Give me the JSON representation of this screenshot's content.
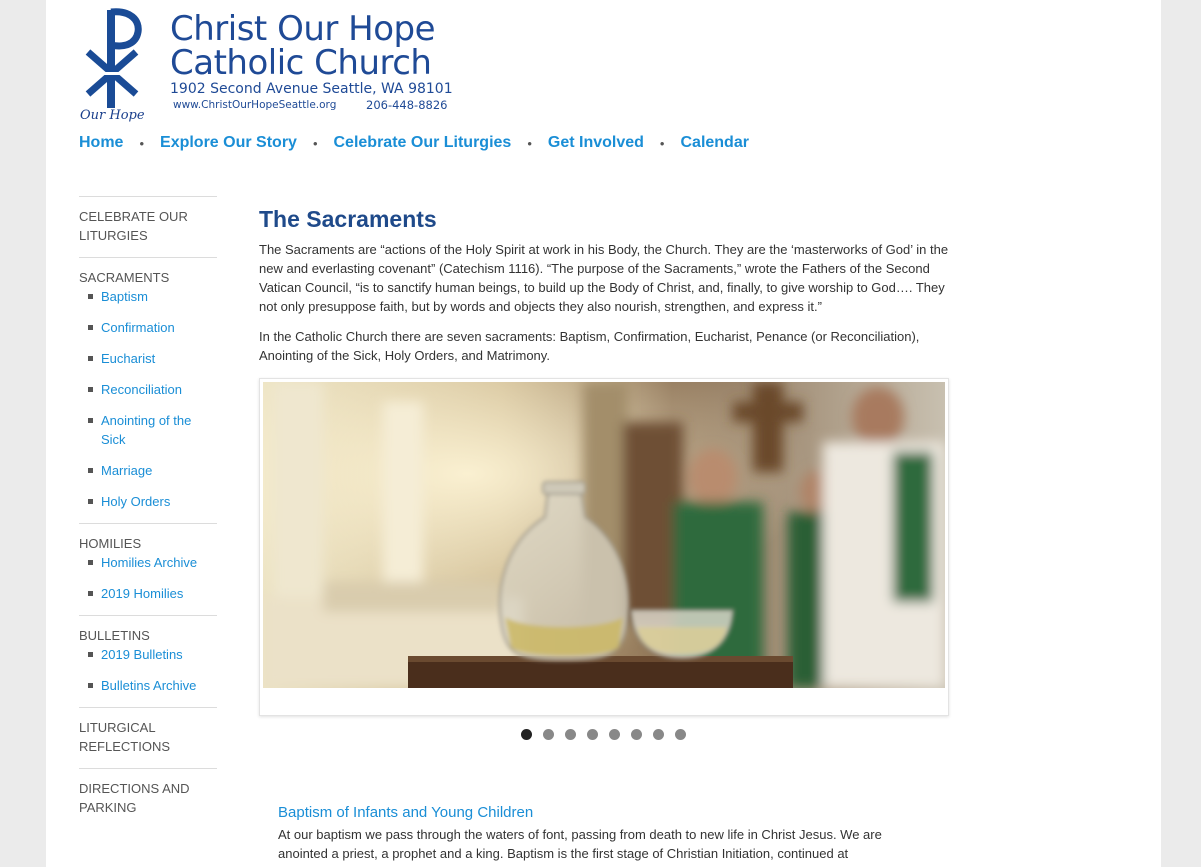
{
  "header": {
    "logo_caption": "Our Hope",
    "title_line1": "Christ Our Hope",
    "title_line2": "Catholic Church",
    "address": "1902 Second Avenue Seattle, WA 98101",
    "website": "www.ChristOurHopeSeattle.org",
    "phone": "206-448-8826",
    "logo_color": "#1a4b96"
  },
  "nav": {
    "items": [
      "Home",
      "Explore Our Story",
      "Celebrate Our Liturgies",
      "Get Involved",
      "Calendar"
    ],
    "separator": "•"
  },
  "sidebar": {
    "celebrate": "CELEBRATE OUR LITURGIES",
    "sacraments": {
      "heading": "SACRAMENTS",
      "items": [
        "Baptism",
        "Confirmation",
        "Eucharist",
        "Reconciliation",
        "Anointing of the Sick",
        "Marriage",
        "Holy Orders"
      ]
    },
    "homilies": {
      "heading": "HOMILIES",
      "items": [
        "Homilies Archive",
        "2019 Homilies"
      ]
    },
    "bulletins": {
      "heading": "BULLETINS",
      "items": [
        "2019 Bulletins",
        "Bulletins Archive"
      ]
    },
    "liturgical": "LITURGICAL REFLECTIONS",
    "directions": "DIRECTIONS AND PARKING"
  },
  "main": {
    "title": "The Sacraments",
    "para1": "The Sacraments are “actions of the Holy Spirit at work in his Body, the Church.  They are the ‘masterworks of God’ in the new and everlasting covenant” (Catechism 1116).  “The purpose of the Sacraments,” wrote the Fathers of the Second Vatican Council, “is to sanctify human beings, to build up the Body of Christ, and, finally, to give worship to God…. They not only presuppose faith, but by words and objects they also nourish, strengthen, and express it.”",
    "para2": "In the Catholic Church there are seven sacraments:  Baptism, Confirmation, Eucharist, Penance (or Reconciliation), Anointing of the Sick, Holy Orders, and Matrimony.",
    "slider_total": 8,
    "slider_active": 1,
    "feature_title": "Baptism of Infants and Young Children",
    "feature_text": "At our baptism we pass through the waters of font, passing from death to new life in Christ Jesus.  We are anointed a priest, a prophet and a king.  Baptism is the first stage of Christian Initiation, continued at"
  },
  "colors": {
    "link": "#1a8ed6",
    "heading": "#1f4a8a",
    "brand": "#1f4a96"
  }
}
